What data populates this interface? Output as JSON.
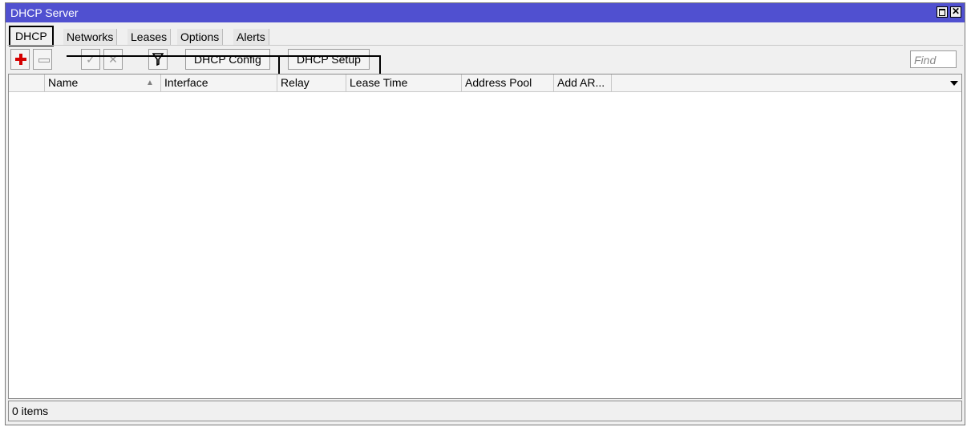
{
  "window": {
    "title": "DHCP Server"
  },
  "tabs": [
    "DHCP",
    "Networks",
    "Leases",
    "Options",
    "Alerts"
  ],
  "toolbar": {
    "dhcp_config_label": "DHCP Config",
    "dhcp_setup_label": "DHCP Setup",
    "find_placeholder": "Find"
  },
  "table": {
    "columns": [
      "Name",
      "Interface",
      "Relay",
      "Lease Time",
      "Address Pool",
      "Add AR..."
    ],
    "rows": []
  },
  "status": {
    "items_label": "0 items"
  }
}
